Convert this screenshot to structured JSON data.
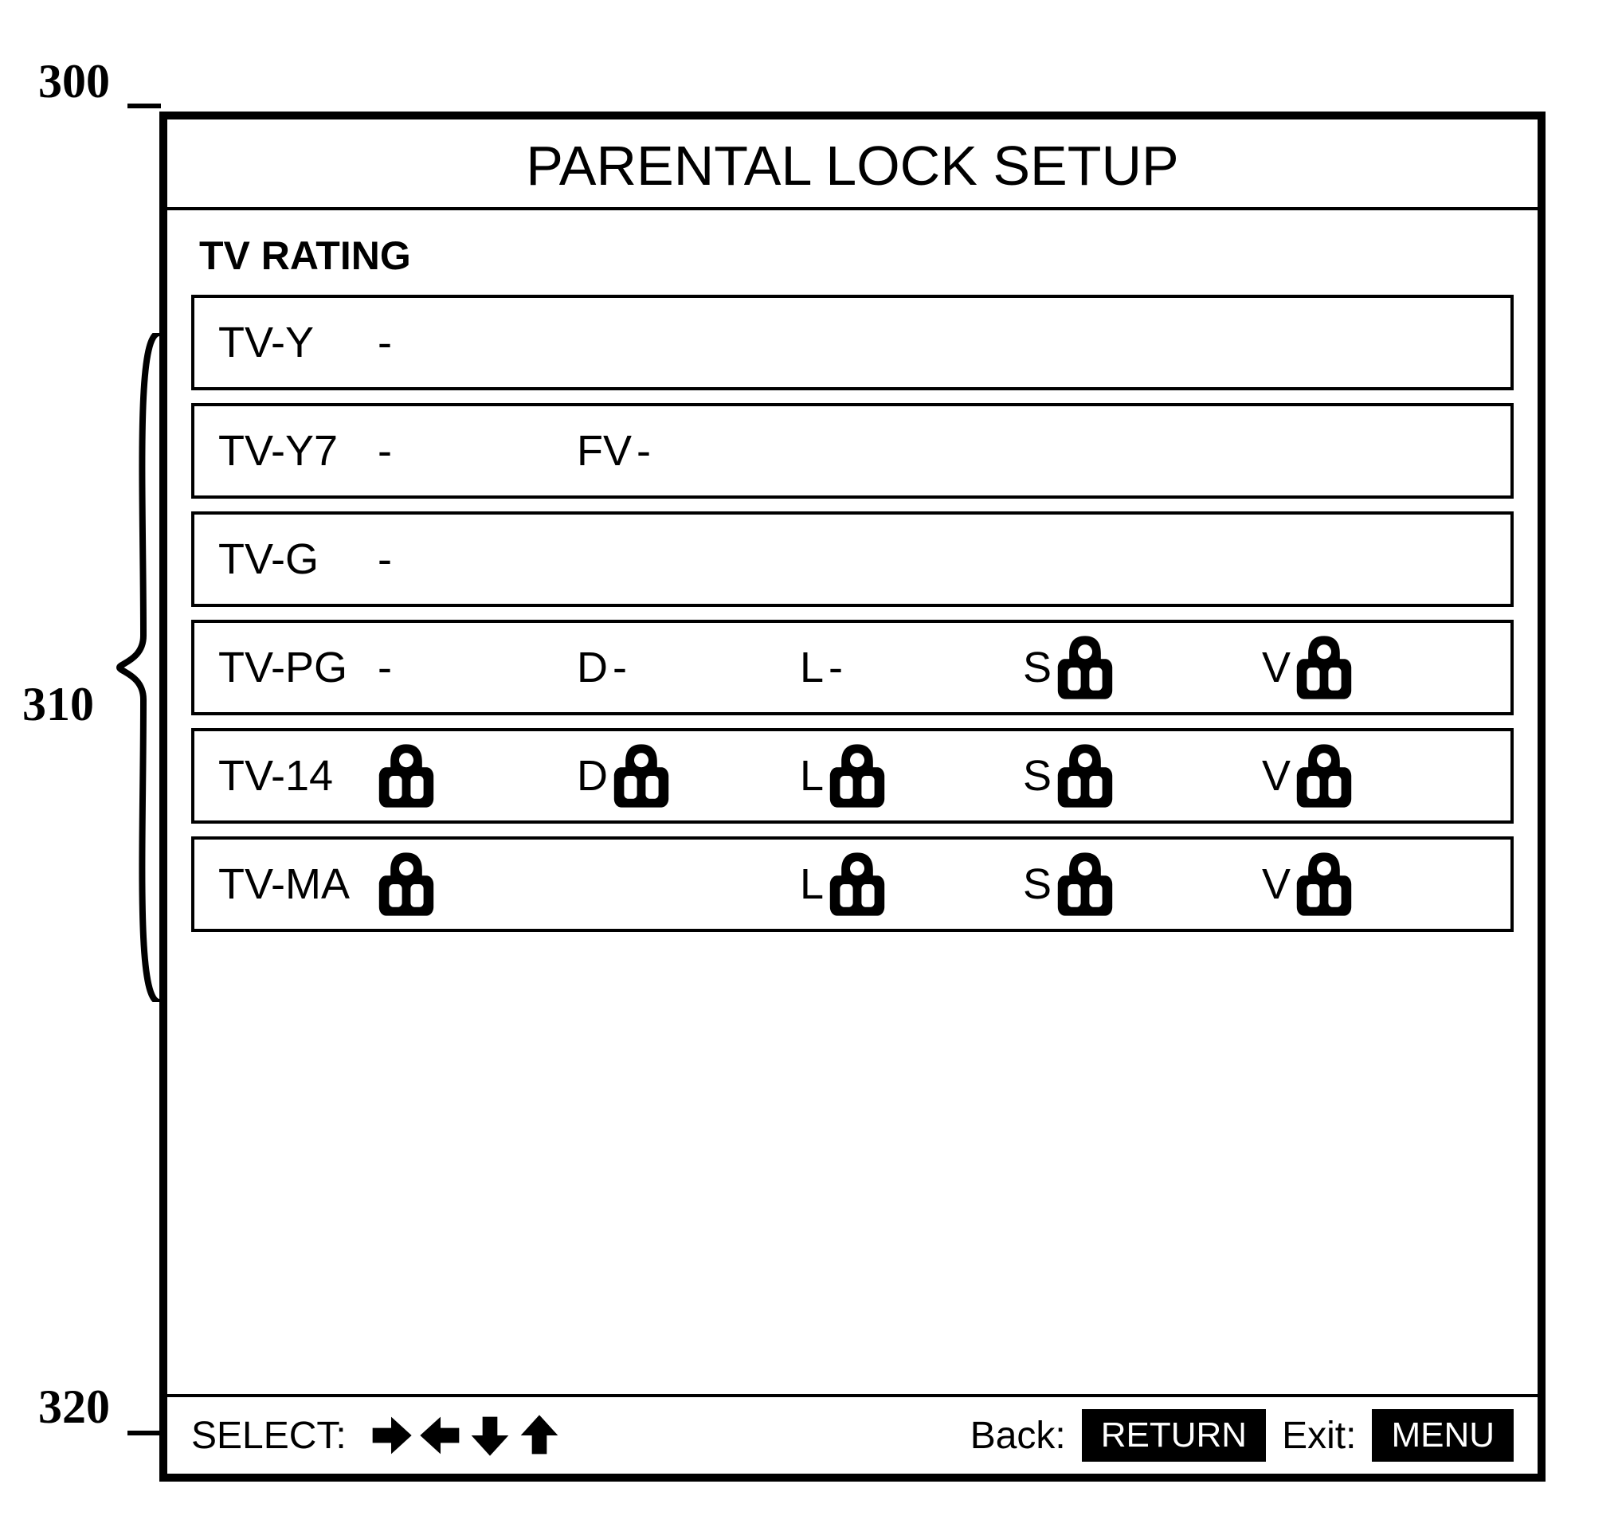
{
  "callouts": {
    "panel": "300",
    "list": "310",
    "footer": "320"
  },
  "title": "PARENTAL LOCK SETUP",
  "section_label": "TV RATING",
  "ratings": [
    {
      "label": "TV-Y",
      "base": "-",
      "cols": [
        null,
        null,
        null,
        null
      ]
    },
    {
      "label": "TV-Y7",
      "base": "-",
      "cols": [
        {
          "t": "FV",
          "s": "dash"
        },
        null,
        null,
        null
      ]
    },
    {
      "label": "TV-G",
      "base": "-",
      "cols": [
        null,
        null,
        null,
        null
      ]
    },
    {
      "label": "TV-PG",
      "base": "-",
      "cols": [
        {
          "t": "D",
          "s": "dash"
        },
        {
          "t": "L",
          "s": "dash"
        },
        {
          "t": "S",
          "s": "lock"
        },
        {
          "t": "V",
          "s": "lock"
        }
      ]
    },
    {
      "label": "TV-14",
      "base": "lock",
      "cols": [
        {
          "t": "D",
          "s": "lock"
        },
        {
          "t": "L",
          "s": "lock"
        },
        {
          "t": "S",
          "s": "lock"
        },
        {
          "t": "V",
          "s": "lock"
        }
      ]
    },
    {
      "label": "TV-MA",
      "base": "lock",
      "cols": [
        null,
        {
          "t": "L",
          "s": "lock"
        },
        {
          "t": "S",
          "s": "lock"
        },
        {
          "t": "V",
          "s": "lock"
        }
      ]
    }
  ],
  "footer": {
    "select_label": "SELECT:",
    "back_label": "Back:",
    "return_btn": "RETURN",
    "exit_label": "Exit:",
    "menu_btn": "MENU"
  }
}
